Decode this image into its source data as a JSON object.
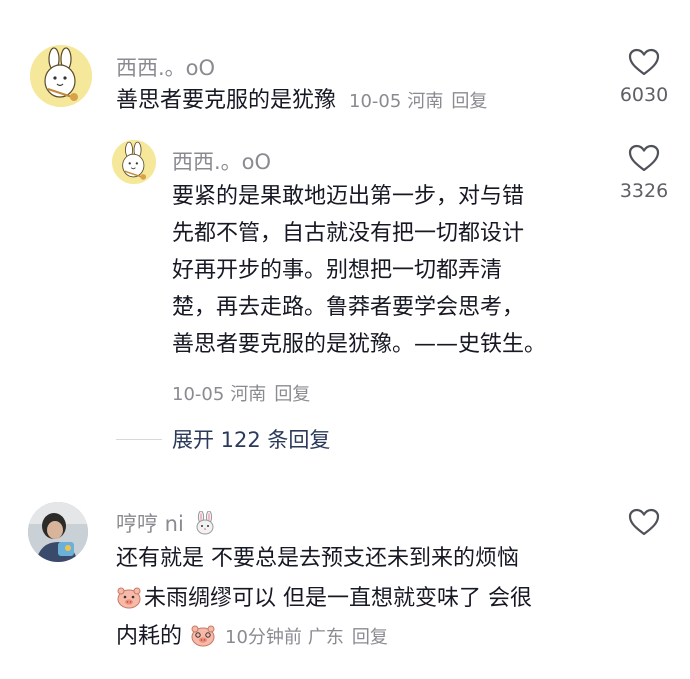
{
  "comments": [
    {
      "username": "西西.。oO",
      "text": "善思者要克服的是犹豫",
      "date": "10-05",
      "location": "河南",
      "reply_label": "回复",
      "likes": "6030",
      "avatar_icon": "cartoon-rabbit-avatar",
      "replies": [
        {
          "username": "西西.。oO",
          "lines": [
            "要紧的是果敢地迈出第一步，对与错",
            "先都不管，自古就没有把一切都设计",
            "好再开步的事。别想把一切都弄清",
            "楚，再去走路。鲁莽者要学会思考，",
            "善思者要克服的是犹豫。——史铁生。"
          ],
          "date": "10-05",
          "location": "河南",
          "reply_label": "回复",
          "likes": "3326",
          "avatar_icon": "cartoon-rabbit-avatar"
        }
      ],
      "expand_label": "展开 122 条回复"
    },
    {
      "username": "哼哼 ni",
      "username_emoji": "rabbit-emoji",
      "lines": [
        "还有就是 不要总是去预支还未到来的烦恼",
        "未雨绸缪可以 但是一直想就变味了 会很",
        "内耗的"
      ],
      "time": "10分钟前",
      "location": "广东",
      "reply_label": "回复",
      "likes": "",
      "avatar_icon": "user-photo-avatar"
    }
  ],
  "colors": {
    "primary_text": "#161823",
    "secondary_text": "#8a8b91",
    "link_text": "#2b3a5a",
    "icon_stroke": "#505259"
  }
}
